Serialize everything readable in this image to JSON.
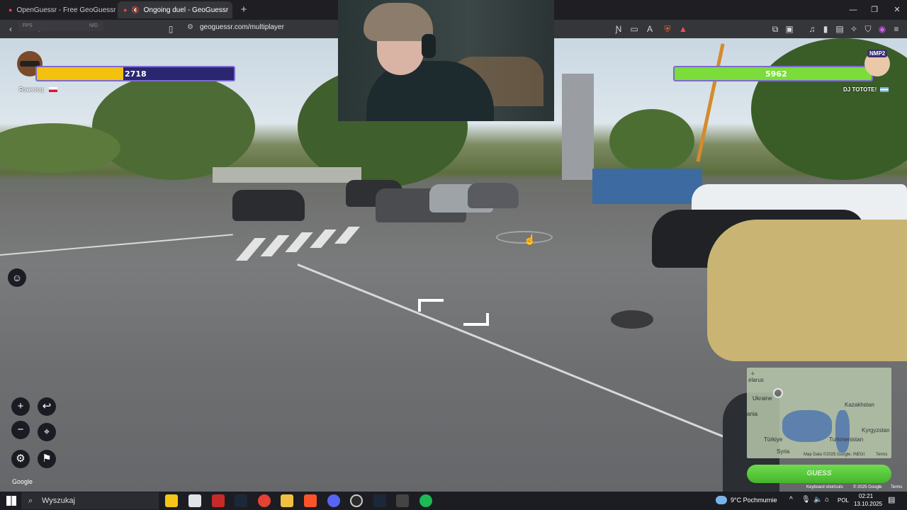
{
  "browser": {
    "tabs": [
      {
        "title": "OpenGuessr - Free GeoGuessr Altern",
        "icon": "pin-icon"
      },
      {
        "title": "Ongoing duel - GeoGuessr",
        "icon": "pin-icon",
        "muted": true
      }
    ],
    "fps_label": "FPS",
    "fps_value": "N/D",
    "url": "geoguessr.com/multiplayer"
  },
  "duel": {
    "player_left": {
      "name": "Roweroq",
      "score": "2718",
      "fill_percent": 44,
      "bar_color": "#f2c20e"
    },
    "player_right": {
      "name": "DJ TOTOTE!",
      "badge": "NMP2",
      "score": "5962",
      "fill_percent": 100,
      "bar_color": "#7bdc3a"
    }
  },
  "map": {
    "labels": [
      "elarus",
      "Ukraine",
      "ania",
      "Kazakhstan",
      "Kyrgyzstan",
      "Turkmenistan",
      "Türkiye",
      "Syria"
    ],
    "attribution": "Map Data ©2025 Google, INEGI",
    "terms": "Terms",
    "guess_label": "GUESS"
  },
  "footer": {
    "keyboard_shortcuts": "Keyboard shortcuts",
    "copyright": "© 2025 Google",
    "terms": "Terms",
    "google_logo": "Google"
  },
  "taskbar": {
    "search_placeholder": "Wyszukaj",
    "weather": "9°C Pochmurnie",
    "language": "POL",
    "time": "02:21",
    "date": "13.10.2025"
  }
}
